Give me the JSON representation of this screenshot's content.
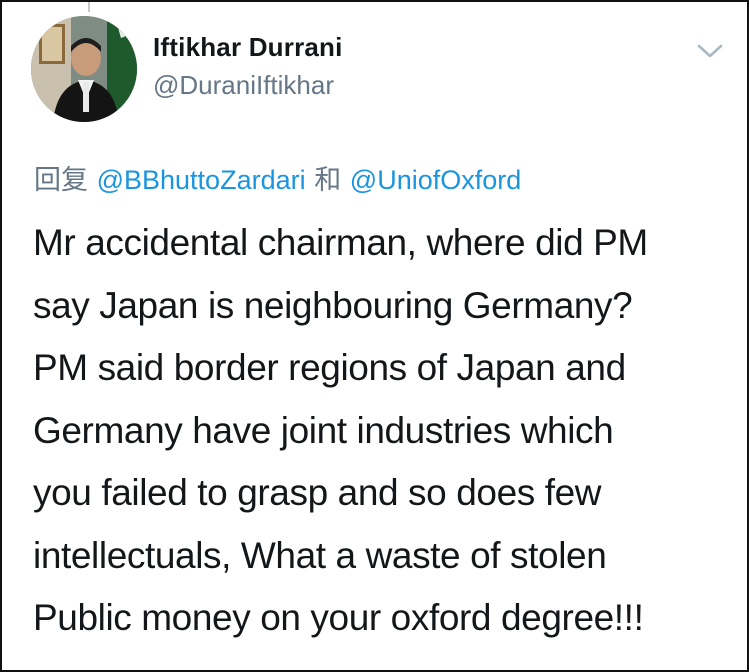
{
  "author": {
    "name": "Iftikhar Durrani",
    "handle": "@DuraniIftikhar"
  },
  "reply": {
    "prefix": "回复",
    "mention_1": "@BBhuttoZardari",
    "conjunction": "和",
    "mention_2": "@UniofOxford"
  },
  "tweet": {
    "lines": [
      "Mr accidental chairman, where did PM",
      "say Japan is neighbouring Germany?",
      "PM said border regions of Japan and",
      "Germany have joint industries which",
      "you failed to grasp and so does few",
      "intellectuals, What a waste of stolen",
      "Public money on your oxford degree!!!"
    ]
  },
  "colors": {
    "text": "#14171a",
    "secondary": "#657786",
    "link": "#1b95e0",
    "chevron": "#aab8c2"
  },
  "icons": {
    "menu": "chevron-down-icon",
    "avatar": "profile-photo"
  }
}
